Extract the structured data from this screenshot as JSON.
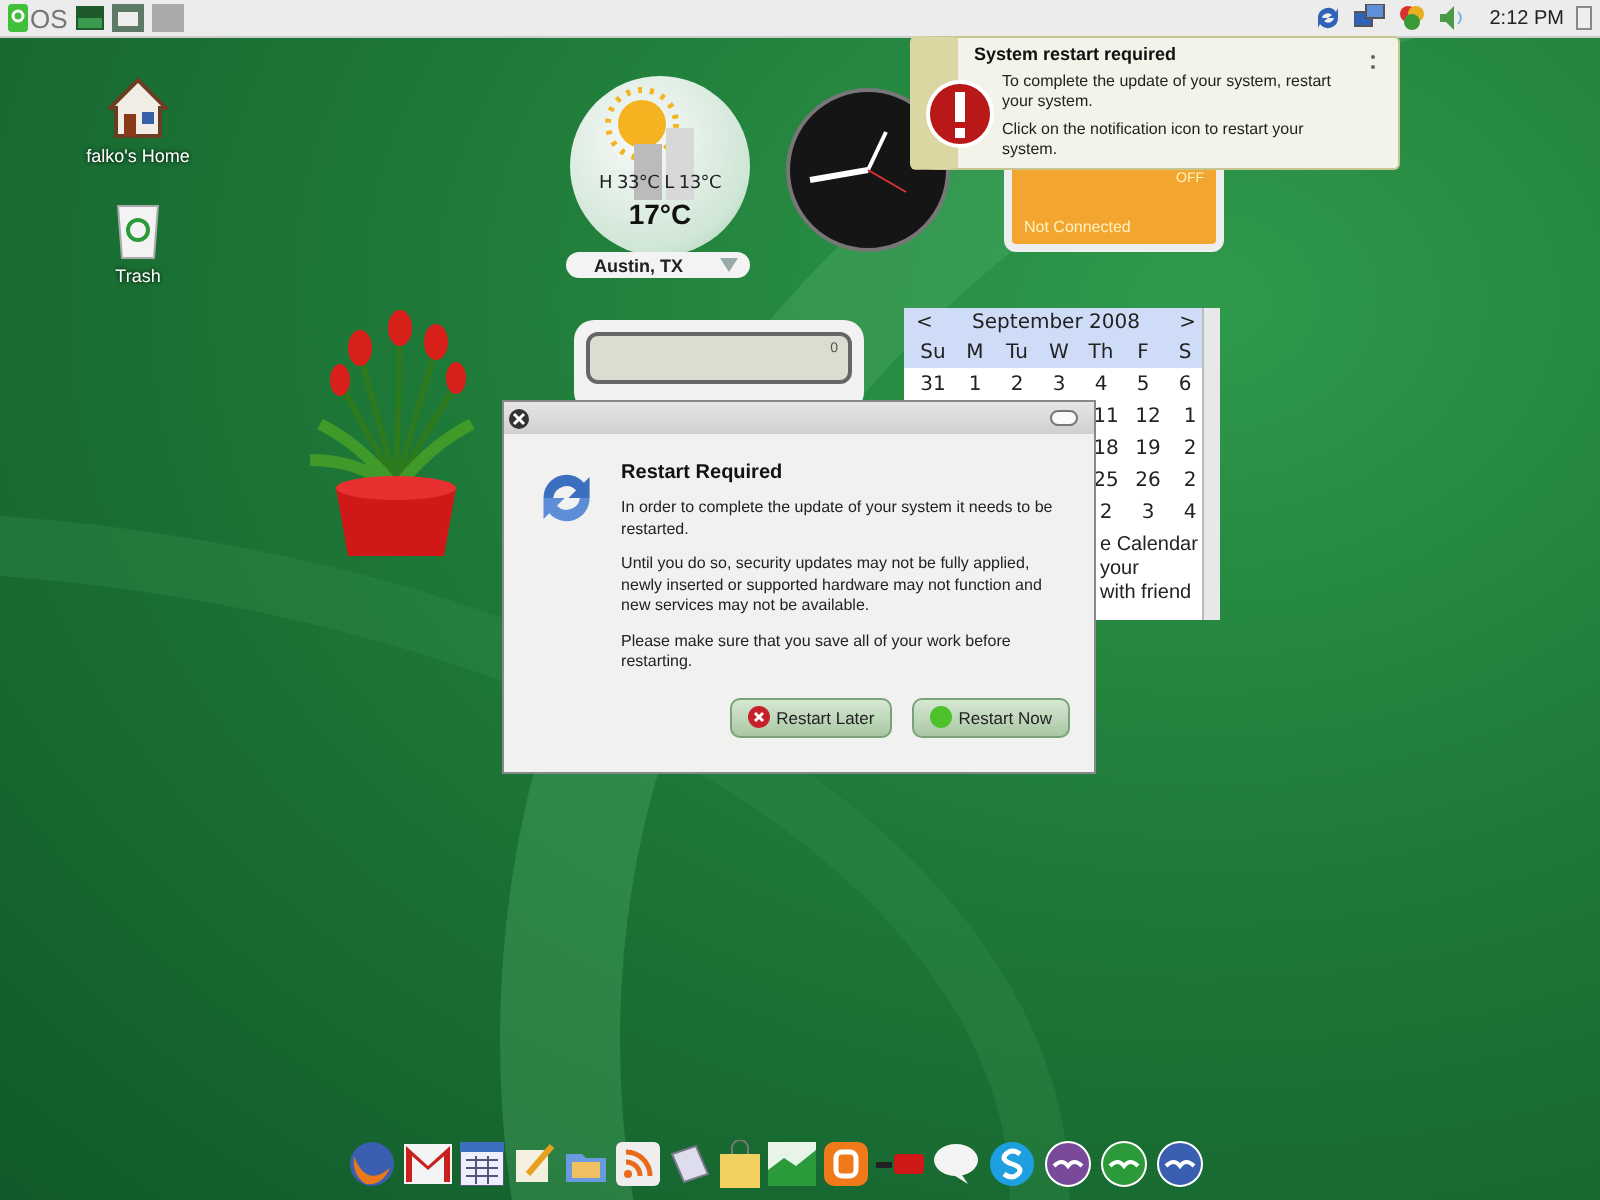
{
  "panel": {
    "logo": "OS",
    "clock": "2:12 PM"
  },
  "desktop_icons": [
    {
      "kind": "home",
      "label": "falko's Home"
    },
    {
      "kind": "trash",
      "label": "Trash"
    }
  ],
  "weather": {
    "high_low": "H 33°C L 13°C",
    "temperature": "17°C",
    "location": "Austin, TX"
  },
  "wifi_widget": {
    "status": "OFF",
    "connection": "Not Connected"
  },
  "calculator": {
    "display": "0"
  },
  "calendar": {
    "prev": "<",
    "month": "September 2008",
    "next": ">",
    "weekdays": [
      "Su",
      "M",
      "Tu",
      "W",
      "Th",
      "F",
      "S"
    ],
    "weeks": [
      [
        "31",
        "1",
        "2",
        "3",
        "4",
        "5",
        "6"
      ],
      [
        "11",
        "12",
        "1"
      ],
      [
        "18",
        "19",
        "2"
      ],
      [
        "25",
        "26",
        "2"
      ],
      [
        "2",
        "3",
        "4"
      ]
    ],
    "note_lines": [
      "e Calendar",
      "your",
      "with friend"
    ]
  },
  "notification": {
    "title": "System restart required",
    "paragraphs": [
      "To complete the update of your system, restart your system.",
      "Click on the notification icon to restart your system."
    ]
  },
  "dialog": {
    "title": "Restart Required",
    "paragraphs": [
      "In order to complete the update of your system it needs to be restarted.",
      "Until you do so, security updates may not be fully applied, newly inserted or supported hardware may not function and new services may not be available.",
      "Please make sure that you save all of your work before restarting."
    ],
    "buttons": [
      {
        "kind": "cancel",
        "label": "Restart Later"
      },
      {
        "kind": "confirm",
        "label": "Restart Now"
      }
    ]
  }
}
